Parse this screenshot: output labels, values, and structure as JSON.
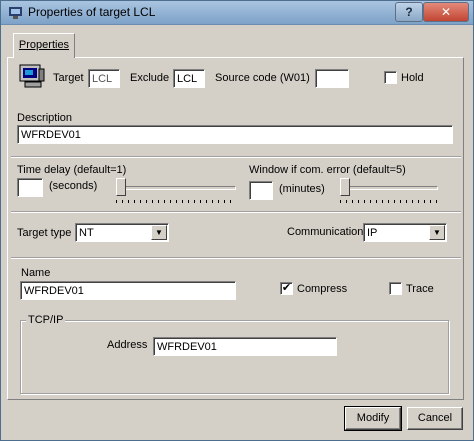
{
  "window": {
    "title": "Properties of target LCL",
    "help_label": "?",
    "close_label": "✕"
  },
  "tabs": [
    {
      "label": "Properties"
    }
  ],
  "target": {
    "icon": "terminal-icon",
    "target_label": "Target",
    "target_value": "LCL",
    "exclude_label": "Exclude",
    "exclude_value": "LCL",
    "source_code_label": "Source code (W01)",
    "source_code_value": "",
    "hold_label": "Hold",
    "hold_checked": false
  },
  "description": {
    "label": "Description",
    "value": "WFRDEV01"
  },
  "time_delay": {
    "label": "Time delay (default=1)",
    "value": "",
    "unit": "(seconds)",
    "slider_level": 0.0
  },
  "window_error": {
    "label": "Window if com. error (default=5)",
    "value": "",
    "unit": "(minutes)",
    "slider_level": 0.0
  },
  "target_type": {
    "label": "Target type",
    "value": "NT"
  },
  "communication": {
    "label": "Communication",
    "value": "IP"
  },
  "name": {
    "label": "Name",
    "value": "WFRDEV01"
  },
  "compress": {
    "label": "Compress",
    "checked": true,
    "mark": "✔"
  },
  "trace": {
    "label": "Trace",
    "checked": false
  },
  "tcpip": {
    "label": "TCP/IP",
    "address_label": "Address",
    "address_value": "WFRDEV01"
  },
  "buttons": {
    "modify_label": "Modify",
    "cancel_label": "Cancel"
  }
}
